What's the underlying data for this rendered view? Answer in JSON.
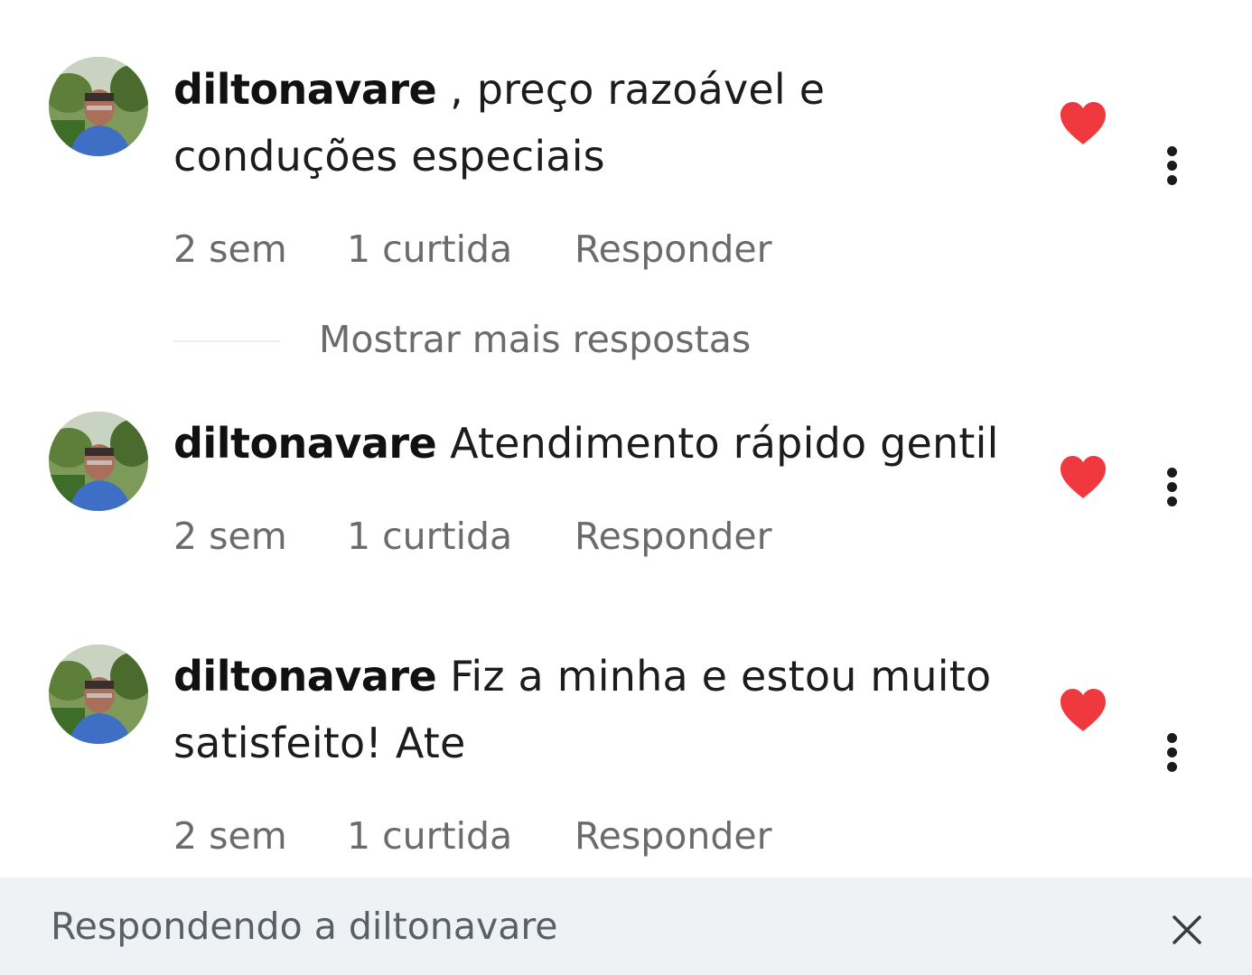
{
  "comments": [
    {
      "username": "diltonavare",
      "text": " , preço razoável e conduções especiais",
      "time": "2 sem",
      "likes": "1 curtida",
      "reply_label": "Responder",
      "liked": true
    },
    {
      "username": "diltonavare",
      "text": " Atendimento rápido gentil",
      "time": "2 sem",
      "likes": "1 curtida",
      "reply_label": "Responder",
      "liked": true
    },
    {
      "username": "diltonavare",
      "text": " Fiz a minha e estou muito satisfeito!  Ate",
      "time": "2 sem",
      "likes": "1 curtida",
      "reply_label": "Responder",
      "liked": true
    }
  ],
  "show_more_replies": "Mostrar mais respostas",
  "reply_bar": {
    "label": "Respondendo a diltonavare"
  },
  "colors": {
    "heart": "#f0383f",
    "meta_text": "#6b6b6b",
    "reply_bar_bg": "#eff2f5"
  }
}
